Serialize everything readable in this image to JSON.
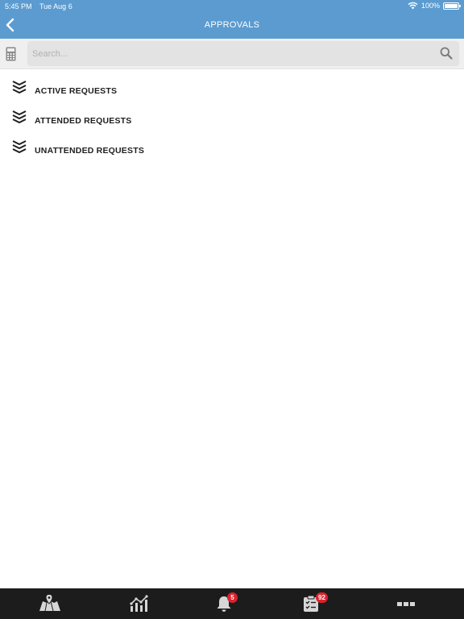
{
  "status_bar": {
    "time": "5:45 PM",
    "date": "Tue Aug 6",
    "battery": "100%"
  },
  "header": {
    "title": "APPROVALS"
  },
  "search": {
    "placeholder": "Search..."
  },
  "requests": [
    {
      "label": "ACTIVE REQUESTS"
    },
    {
      "label": "ATTENDED REQUESTS"
    },
    {
      "label": "UNATTENDED REQUESTS"
    }
  ],
  "tab_bar": {
    "tabs": [
      {
        "icon": "map-icon",
        "badge": ""
      },
      {
        "icon": "chart-icon",
        "badge": ""
      },
      {
        "icon": "bell-icon",
        "badge": "5"
      },
      {
        "icon": "checklist-icon",
        "badge": "92"
      },
      {
        "icon": "more-icon",
        "badge": ""
      }
    ]
  },
  "colors": {
    "header": "#5b9bd0",
    "tab_bar": "#1c1c1c",
    "badge": "#d9232e"
  }
}
